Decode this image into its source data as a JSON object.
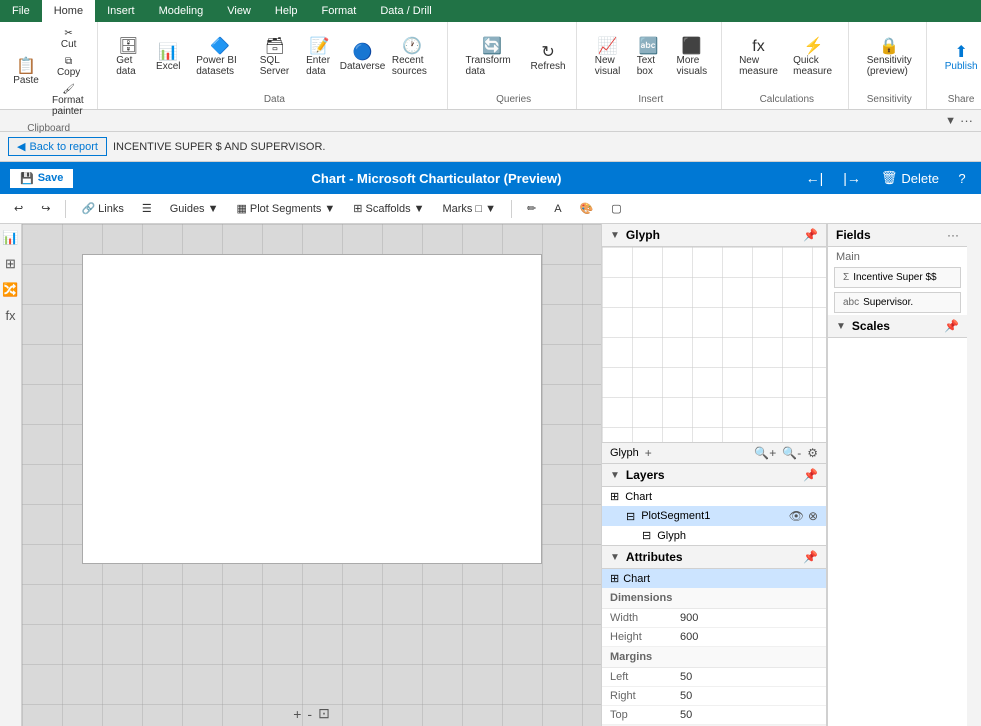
{
  "menu": {
    "items": [
      "File",
      "Home",
      "Insert",
      "Modeling",
      "View",
      "Help",
      "Format",
      "Data / Drill"
    ],
    "active": "Home"
  },
  "ribbon": {
    "clipboard_label": "Clipboard",
    "data_label": "Data",
    "queries_label": "Queries",
    "insert_label": "Insert",
    "calculations_label": "Calculations",
    "sensitivity_label": "Sensitivity",
    "share_label": "Share",
    "buttons": {
      "paste": "Paste",
      "cut": "Cut",
      "copy": "Copy",
      "format_painter": "Format painter",
      "get_data": "Get data",
      "excel": "Excel",
      "power_bi": "Power BI datasets",
      "sql_server": "SQL Server",
      "enter_data": "Enter data",
      "dataverse": "Dataverse",
      "recent_sources": "Recent sources",
      "transform": "Transform data",
      "refresh": "Refresh",
      "new_visual": "New visual",
      "text_box": "Text box",
      "more_visuals": "More visuals",
      "new_measure": "New measure",
      "quick_measure": "Quick measure",
      "sensitivity": "Sensitivity (preview)",
      "publish": "Publish"
    }
  },
  "toolbar2": {
    "filter_icon": "▼"
  },
  "breadcrumb": {
    "back_label": "Back to report",
    "title": "INCENTIVE SUPER $ AND SUPERVISOR."
  },
  "chart_title_bar": {
    "save_label": "Save",
    "title": "Chart - Microsoft Charticulator (Preview)",
    "delete_label": "Delete",
    "help_label": "?"
  },
  "chart_toolbar": {
    "undo": "↩",
    "redo": "↪",
    "links_label": "Links",
    "guides_label": "Guides",
    "plot_segments_label": "Plot Segments",
    "scaffolds_label": "Scaffolds",
    "marks_label": "Marks",
    "pencil": "✏",
    "text_icon": "A",
    "paint_icon": "🎨",
    "eraser_icon": "⬜"
  },
  "glyph_panel": {
    "title": "Glyph",
    "add_icon": "+",
    "zoom_in": "🔍+",
    "zoom_out": "🔍-",
    "settings": "⚙"
  },
  "layers_panel": {
    "title": "Layers",
    "items": [
      {
        "label": "Chart",
        "icon": "⊞",
        "indent": 0
      },
      {
        "label": "PlotSegment1",
        "icon": "⊟",
        "indent": 1,
        "selected": true
      },
      {
        "label": "Glyph",
        "icon": "⊟",
        "indent": 2
      }
    ]
  },
  "attributes_panel": {
    "title": "Attributes",
    "chart_label": "Chart",
    "dimensions_label": "Dimensions",
    "width_label": "Width",
    "width_value": "900",
    "height_label": "Height",
    "height_value": "600",
    "margins_label": "Margins",
    "left_label": "Left",
    "left_value": "50",
    "right_label": "Right",
    "right_value": "50",
    "top_label": "Top",
    "top_value": "50"
  },
  "fields_panel": {
    "title": "Fields",
    "more_icon": "···",
    "main_label": "Main",
    "fields": [
      {
        "label": "Incentive Super $$",
        "type": "sigma"
      },
      {
        "label": "Supervisor.",
        "type": "text"
      }
    ]
  },
  "scales_panel": {
    "title": "Scales",
    "pin_icon": "📌"
  },
  "canvas": {
    "zoom_in": "+",
    "zoom_out": "-",
    "fit": "⊡"
  }
}
